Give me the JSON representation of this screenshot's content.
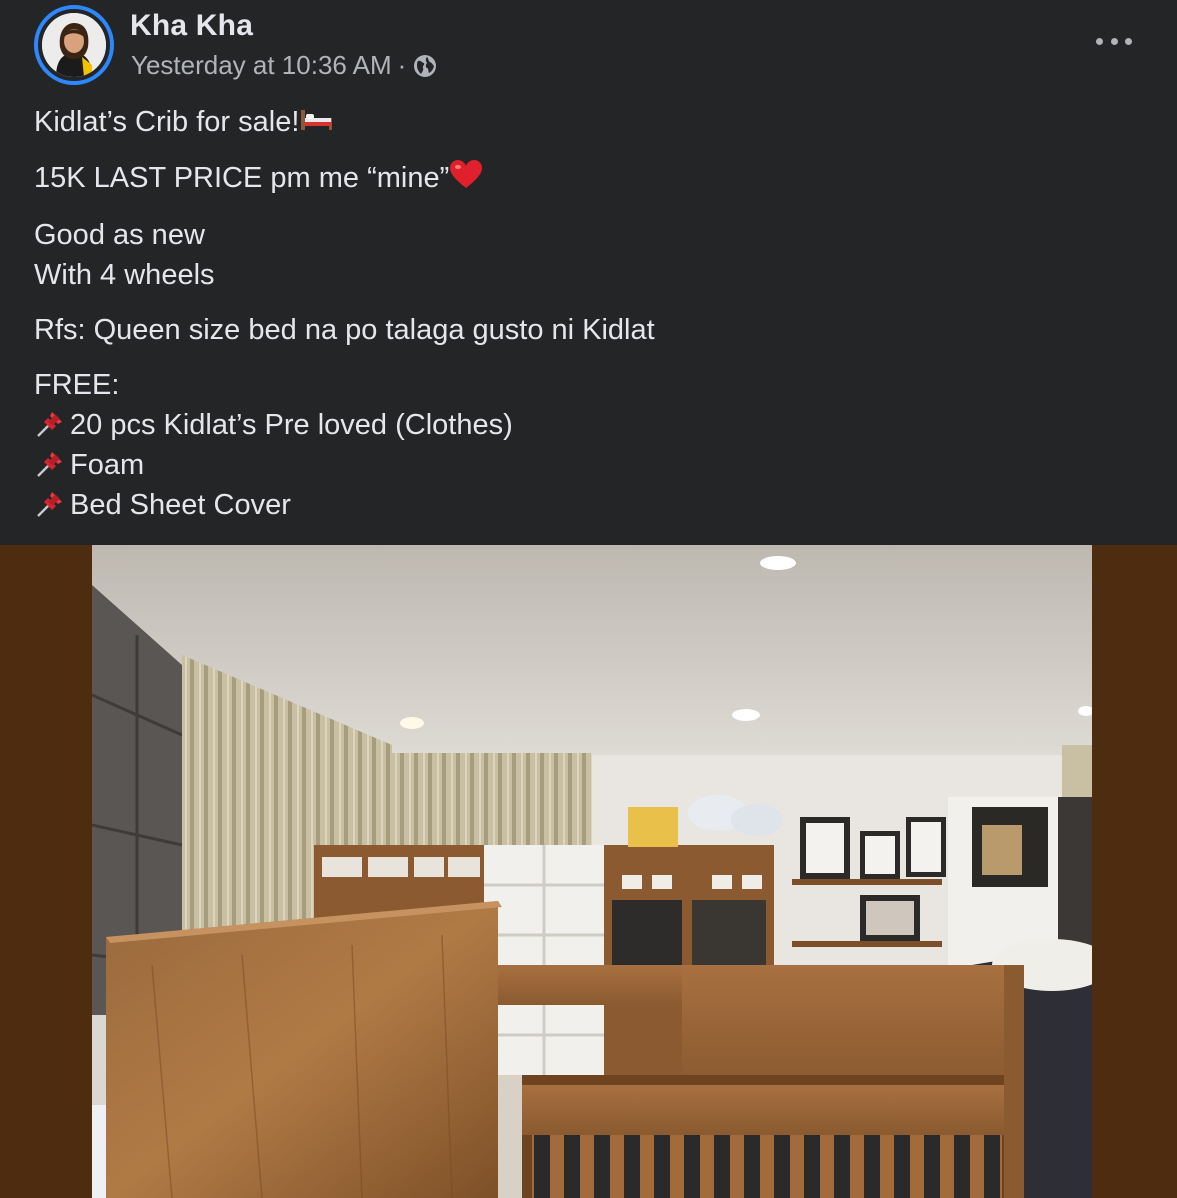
{
  "post": {
    "author_name": "Kha Kha",
    "timestamp": "Yesterday at 10:36 AM",
    "separator": "·",
    "audience_icon": "globe-icon",
    "more_icon": "more-options-icon",
    "lines": {
      "title": "Kidlat’s Crib for sale!",
      "price": "15K LAST PRICE pm me “mine”",
      "condition_1": "Good as new",
      "condition_2": "With 4 wheels",
      "reason": "Rfs: Queen size bed na po talaga gusto ni Kidlat",
      "free_heading": "FREE:",
      "free_items": [
        "20 pcs Kidlat’s Pre loved (Clothes)",
        "Foam",
        "Bed Sheet Cover"
      ]
    },
    "emojis": {
      "title": "bed-emoji",
      "price": "red-heart-emoji",
      "list_bullet": "pushpin-emoji"
    },
    "photo_description_icon": "crib-photo"
  },
  "colors": {
    "background": "#242526",
    "text_primary": "#e4e6eb",
    "text_secondary": "#b0b3b8",
    "avatar_ring": "#2d88ff",
    "photo_backdrop": "#4e2c10"
  }
}
